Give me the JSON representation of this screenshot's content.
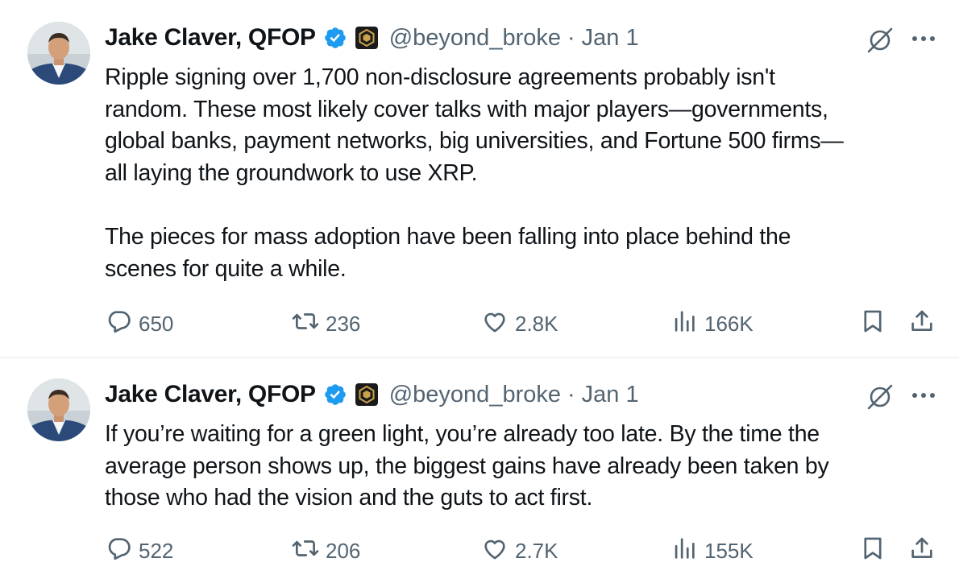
{
  "tweets": [
    {
      "author": {
        "name": "Jake Claver, QFOP",
        "handle": "@beyond_broke",
        "verified": true,
        "affiliate_badge": "hexagon-badge-icon"
      },
      "date": "Jan 1",
      "separator": "·",
      "paragraphs": [
        "Ripple signing over 1,700 non-disclosure agreements probably isn't\nrandom. These most likely cover talks with major players—governments,\nglobal banks, payment networks, big universities, and Fortune 500 firms—\nall laying the groundwork to use XRP.",
        "The pieces for mass adoption have been falling into place behind the\nscenes for quite a while."
      ],
      "stats": {
        "replies": "650",
        "reposts": "236",
        "likes": "2.8K",
        "views": "166K"
      }
    },
    {
      "author": {
        "name": "Jake Claver, QFOP",
        "handle": "@beyond_broke",
        "verified": true,
        "affiliate_badge": "hexagon-badge-icon"
      },
      "date": "Jan 1",
      "separator": "·",
      "paragraphs": [
        "If you’re waiting for a green light, you’re already too late.  By the time the\naverage person shows up, the biggest gains have already been taken by\nthose who had the vision and the guts to act first."
      ],
      "stats": {
        "replies": "522",
        "reposts": "206",
        "likes": "2.7K",
        "views": "155K"
      }
    }
  ],
  "colors": {
    "text_primary": "#0f1419",
    "text_secondary": "#536471",
    "verified_blue": "#1d9bf0",
    "divider": "#eff3f4"
  },
  "icons": {
    "verified": "verified-badge-icon",
    "affiliate": "hexagon-badge-icon",
    "grok": "grok-icon",
    "more": "more-dots-icon",
    "reply": "reply-icon",
    "repost": "repost-icon",
    "like": "heart-icon",
    "views": "views-chart-icon",
    "bookmark": "bookmark-icon",
    "share": "share-icon"
  }
}
